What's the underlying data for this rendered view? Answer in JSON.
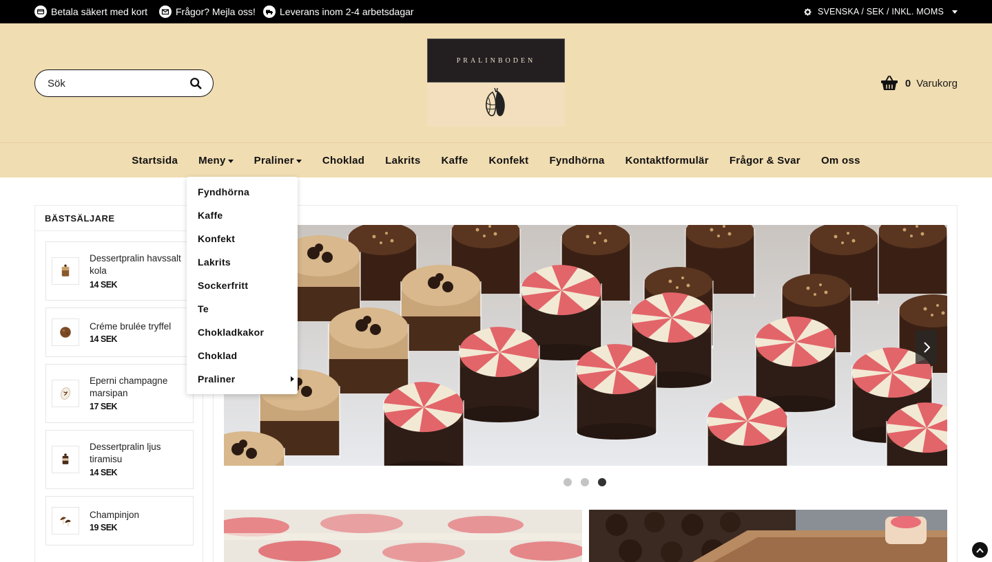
{
  "topbar": {
    "items": [
      {
        "label": "Betala säkert med kort",
        "icon": "credit-card-icon"
      },
      {
        "label": "Frågor? Mejla oss!",
        "icon": "envelope-icon"
      },
      {
        "label": "Leverans inom 2-4 arbetsdagar",
        "icon": "truck-icon"
      }
    ],
    "locale": "SVENSKA / SEK / INKL. MOMS"
  },
  "header": {
    "search_placeholder": "Sök",
    "logo_text": "PRALINBODEN",
    "cart_count": "0",
    "cart_label": "Varukorg"
  },
  "nav": {
    "items": [
      "Startsida",
      "Meny",
      "Praliner",
      "Choklad",
      "Lakrits",
      "Kaffe",
      "Konfekt",
      "Fyndhörna",
      "Kontaktformulär",
      "Frågor & Svar",
      "Om oss"
    ]
  },
  "dropdown": {
    "items": [
      "Fyndhörna",
      "Kaffe",
      "Konfekt",
      "Lakrits",
      "Sockerfritt",
      "Te",
      "Chokladkakor",
      "Choklad",
      "Praliner"
    ]
  },
  "sidebar": {
    "title": "BÄSTSÄLJARE",
    "products": [
      {
        "name": "Dessertpralin havssalt kola",
        "price": "14 SEK"
      },
      {
        "name": "Créme brulée tryffel",
        "price": "14 SEK"
      },
      {
        "name": "Eperni champagne marsipan",
        "price": "17 SEK"
      },
      {
        "name": "Dessertpralin ljus tiramisu",
        "price": "14 SEK"
      },
      {
        "name": "Champinjon",
        "price": "19 SEK"
      }
    ]
  },
  "slider": {
    "slide_count": 3,
    "active_slide": 3
  },
  "colors": {
    "topbar_bg": "#000000",
    "header_bg": "#f1ddb2",
    "text": "#111111"
  }
}
